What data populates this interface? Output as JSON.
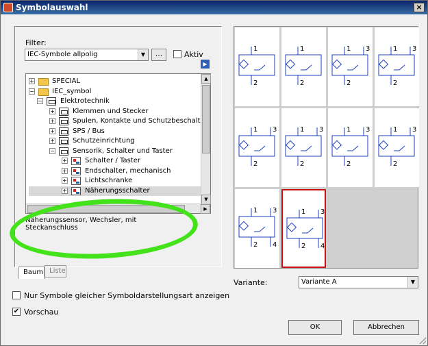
{
  "window": {
    "title": "Symbolauswahl",
    "close_glyph": "×"
  },
  "filter": {
    "label": "Filter:",
    "value": "IEC-Symbole allpolig",
    "dots_label": "...",
    "aktiv_label": "Aktiv",
    "arrow_glyph": "▶"
  },
  "tree": {
    "nodes": [
      {
        "label": "SPECIAL",
        "icon": "folder-icon",
        "expander": "+"
      },
      {
        "label": "IEC_symbol",
        "icon": "folder-icon",
        "expander": "−"
      },
      {
        "label": "Elektrotechnik",
        "icon": "database-icon",
        "expander": "−"
      },
      {
        "label": "Klemmen und Stecker",
        "icon": "database-icon",
        "expander": "+"
      },
      {
        "label": "Spulen, Kontakte und Schutzbeschaltunge",
        "icon": "database-icon",
        "expander": "+"
      },
      {
        "label": "SPS / Bus",
        "icon": "database-icon",
        "expander": "+"
      },
      {
        "label": "Schutzeinrichtung",
        "icon": "database-icon",
        "expander": "+"
      },
      {
        "label": "Sensorik, Schalter und Taster",
        "icon": "database-icon",
        "expander": "−"
      },
      {
        "label": "Schalter / Taster",
        "icon": "symbol-icon",
        "expander": "+"
      },
      {
        "label": "Endschalter, mechanisch",
        "icon": "symbol-icon",
        "expander": "+"
      },
      {
        "label": "Lichtschranke",
        "icon": "symbol-icon",
        "expander": "+"
      },
      {
        "label": "Näherungsschalter",
        "icon": "symbol-icon",
        "expander": "+",
        "selected": true
      }
    ]
  },
  "description": "Näherungssensor, Wechsler, mit Steckanschluss",
  "tabs": [
    {
      "label": "Baum",
      "active": true
    },
    {
      "label": "Liste",
      "active": false
    }
  ],
  "variante": {
    "label": "Variante:",
    "value": "Variante A"
  },
  "checkboxes": [
    {
      "label": "Nur Symbole gleicher Symboldarstellungsart anzeigen",
      "checked": false
    },
    {
      "label": "Vorschau",
      "checked": true,
      "mark": "✔"
    }
  ],
  "buttons": {
    "ok": "OK",
    "cancel": "Abbrechen"
  },
  "symbols": [
    {
      "top": "1",
      "topright": "",
      "bottom": "2",
      "bottomright": ""
    },
    {
      "top": "1",
      "topright": "",
      "bottom": "2",
      "bottomright": ""
    },
    {
      "top": "1",
      "topright": "3",
      "bottom": "2",
      "bottomright": ""
    },
    {
      "top": "1",
      "topright": "3",
      "bottom": "2",
      "bottomright": ""
    },
    {
      "top": "1",
      "topright": "3",
      "bottom": "2",
      "bottomright": ""
    },
    {
      "top": "1",
      "topright": "3",
      "bottom": "2",
      "bottomright": ""
    },
    {
      "top": "1",
      "topright": "3",
      "bottom": "2",
      "bottomright": ""
    },
    {
      "top": "1",
      "topright": "3",
      "bottom": "2",
      "bottomright": ""
    },
    {
      "top": "1",
      "topright": "3",
      "bottom": "2",
      "bottomright": "4"
    },
    {
      "top": "1",
      "topright": "3",
      "bottom": "2",
      "bottomright": "4",
      "selected": true
    }
  ],
  "colors": {
    "selection_border": "#cc1111",
    "annotation_green": "#44e21a",
    "symbol_blue": "#1a3fbf"
  }
}
